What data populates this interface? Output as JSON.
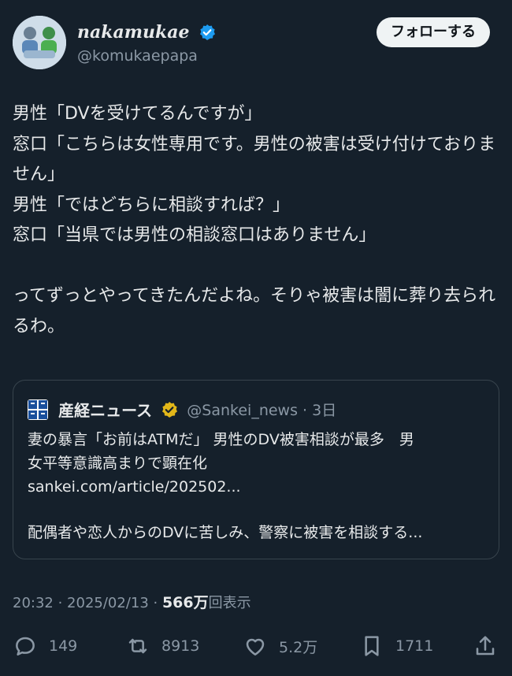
{
  "author": {
    "display_name": "nakamukae",
    "handle": "@komukaepapa",
    "avatar_icon": "avatar-icon",
    "verified_icon": "verified-badge-icon"
  },
  "follow_button": {
    "label": "フォローする"
  },
  "tweet": {
    "text": "男性「DVを受けてるんですが」\n窓口「こちらは女性専用です。男性の被害は受け付けておりません」\n男性「ではどちらに相談すれば？」\n窓口「当県では男性の相談窓口はありません」\n\nってずっとやってきたんだよね。そりゃ被害は闇に葬り去られるわ。"
  },
  "quote": {
    "source_name": "産経ニュース",
    "handle_time": "@Sankei_news · 3日",
    "line1": "妻の暴言「お前はATMだ」 男性のDV被害相談が最多　男",
    "line2": "女平等意識高まりで顕在化",
    "link": "sankei.com/article/202502...",
    "line3": "配偶者や恋人からのDVに苦しみ、警察に被害を相談する..."
  },
  "meta": {
    "time_date": "20:32 · 2025/02/13 · ",
    "views_count": "566万",
    "views_label": "回表示"
  },
  "actions": {
    "replies": "149",
    "retweets": "8913",
    "likes": "5.2万",
    "bookmarks": "1711"
  },
  "colors": {
    "background": "#15202b",
    "text": "#e7e9ea",
    "secondary": "#8b98a5",
    "verified_blue": "#1d9bf0",
    "verified_gold": "#e2b719"
  }
}
